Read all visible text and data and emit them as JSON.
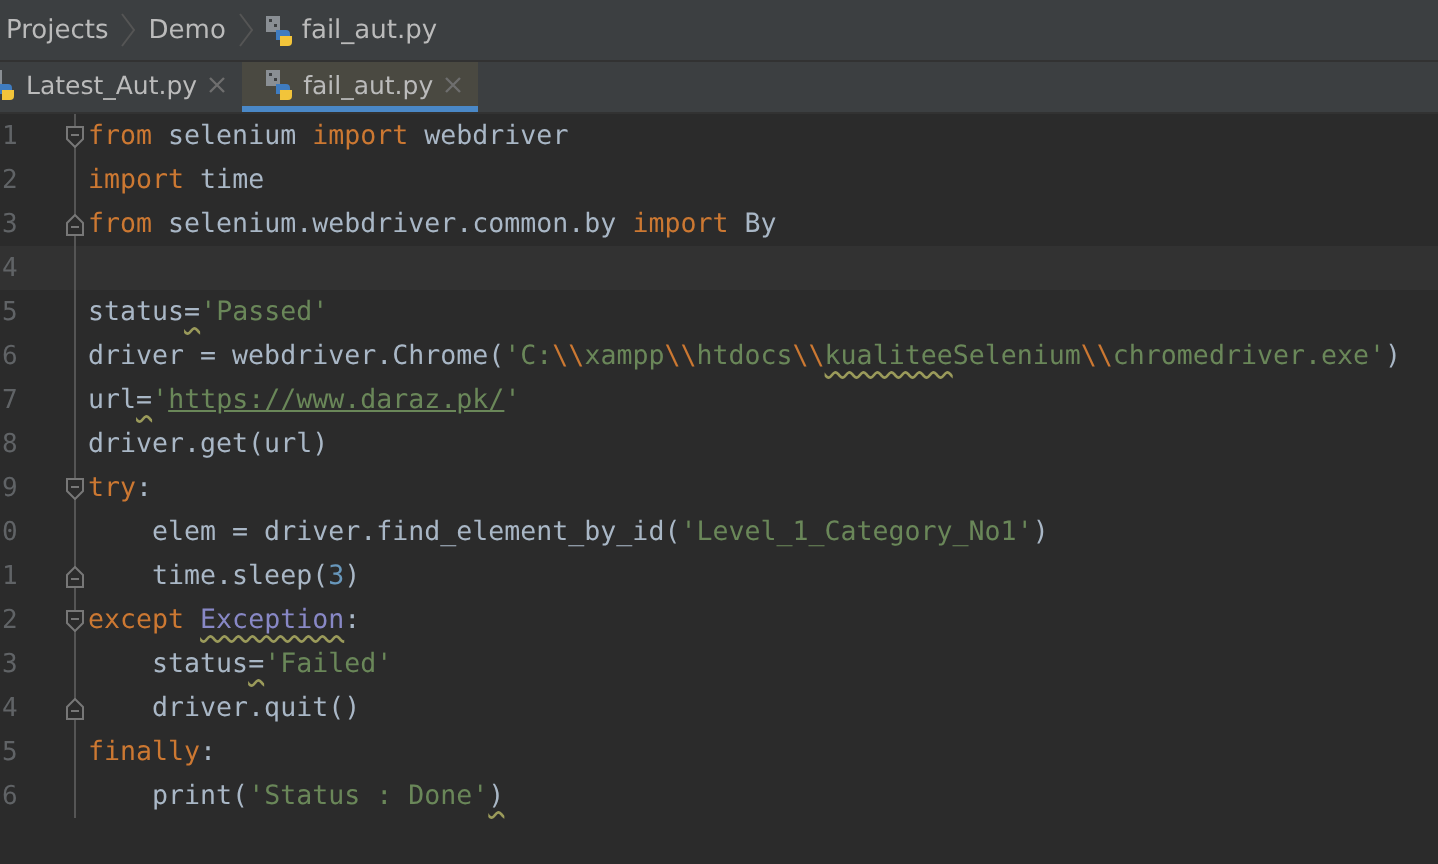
{
  "breadcrumbs": [
    {
      "label": "Projects",
      "kind": "folder"
    },
    {
      "label": "Demo",
      "kind": "folder"
    },
    {
      "label": "fail_aut.py",
      "kind": "file"
    }
  ],
  "tabs": [
    {
      "label": "Latest_Aut.py",
      "selected": false
    },
    {
      "label": "fail_aut.py",
      "selected": true
    }
  ],
  "editor": {
    "lines": [
      {
        "number": "1",
        "fold_open": true,
        "fold_close": false,
        "current": false,
        "tokens": [
          {
            "text": "from",
            "kind": "keyword",
            "warning": false
          },
          {
            "text": " selenium ",
            "kind": "plain",
            "warning": false
          },
          {
            "text": "import",
            "kind": "keyword",
            "warning": false
          },
          {
            "text": " webdriver",
            "kind": "plain",
            "warning": false
          }
        ]
      },
      {
        "number": "2",
        "fold_open": false,
        "fold_close": false,
        "current": false,
        "tokens": [
          {
            "text": "import",
            "kind": "keyword",
            "warning": false
          },
          {
            "text": " time",
            "kind": "plain",
            "warning": false
          }
        ]
      },
      {
        "number": "3",
        "fold_open": false,
        "fold_close": true,
        "current": false,
        "tokens": [
          {
            "text": "from",
            "kind": "keyword",
            "warning": false
          },
          {
            "text": " selenium.webdriver.common.by ",
            "kind": "plain",
            "warning": false
          },
          {
            "text": "import",
            "kind": "keyword",
            "warning": false
          },
          {
            "text": " By",
            "kind": "plain",
            "warning": false
          }
        ]
      },
      {
        "number": "4",
        "fold_open": false,
        "fold_close": false,
        "current": true
      },
      {
        "number": "5",
        "fold_open": false,
        "fold_close": false,
        "current": false,
        "tokens": [
          {
            "text": "status",
            "kind": "plain",
            "warning": false
          },
          {
            "text": "=",
            "kind": "plain",
            "warning": true
          },
          {
            "text": "'Passed'",
            "kind": "string",
            "warning": false
          }
        ]
      },
      {
        "number": "6",
        "fold_open": false,
        "fold_close": false,
        "current": false,
        "tokens": [
          {
            "text": "driver = webdriver.Chrome(",
            "kind": "plain",
            "warning": false
          },
          {
            "text": "'C:",
            "kind": "string",
            "warning": false
          },
          {
            "text": "\\\\",
            "kind": "escape",
            "warning": false
          },
          {
            "text": "xampp",
            "kind": "string",
            "warning": false
          },
          {
            "text": "\\\\",
            "kind": "escape",
            "warning": false
          },
          {
            "text": "htdocs",
            "kind": "string",
            "warning": false
          },
          {
            "text": "\\\\",
            "kind": "escape",
            "warning": false
          },
          {
            "text": "kualitee",
            "kind": "string",
            "warning": true
          },
          {
            "text": "Selenium",
            "kind": "string",
            "warning": false
          },
          {
            "text": "\\\\",
            "kind": "escape",
            "warning": false
          },
          {
            "text": "chromedriver.exe'",
            "kind": "string",
            "warning": false
          },
          {
            "text": ")",
            "kind": "plain",
            "warning": false
          }
        ]
      },
      {
        "number": "7",
        "fold_open": false,
        "fold_close": false,
        "current": false,
        "tokens": [
          {
            "text": "url",
            "kind": "plain",
            "warning": false
          },
          {
            "text": "=",
            "kind": "plain",
            "warning": true
          },
          {
            "text": "'",
            "kind": "string",
            "warning": false
          },
          {
            "text": "https://www.daraz.pk/",
            "kind": "link",
            "warning": false
          },
          {
            "text": "'",
            "kind": "string",
            "warning": false
          }
        ]
      },
      {
        "number": "8",
        "fold_open": false,
        "fold_close": false,
        "current": false,
        "tokens": [
          {
            "text": "driver.get(url)",
            "kind": "plain",
            "warning": false
          }
        ]
      },
      {
        "number": "9",
        "fold_open": true,
        "fold_close": false,
        "current": false,
        "tokens": [
          {
            "text": "try",
            "kind": "keyword",
            "warning": false
          },
          {
            "text": ":",
            "kind": "plain",
            "warning": false
          }
        ]
      },
      {
        "number": "0",
        "fold_open": false,
        "fold_close": false,
        "current": false,
        "tokens": [
          {
            "text": "    elem = driver.find_element_by_id(",
            "kind": "plain",
            "warning": false
          },
          {
            "text": "'Level_1_Category_No1'",
            "kind": "string",
            "warning": false
          },
          {
            "text": ")",
            "kind": "plain",
            "warning": false
          }
        ]
      },
      {
        "number": "1",
        "fold_open": false,
        "fold_close": true,
        "current": false,
        "tokens": [
          {
            "text": "    time.sleep(",
            "kind": "plain",
            "warning": false
          },
          {
            "text": "3",
            "kind": "number",
            "warning": false
          },
          {
            "text": ")",
            "kind": "plain",
            "warning": false
          }
        ]
      },
      {
        "number": "2",
        "fold_open": true,
        "fold_close": false,
        "current": false,
        "tokens": [
          {
            "text": "except ",
            "kind": "keyword",
            "warning": false
          },
          {
            "text": "Exception",
            "kind": "builtin",
            "warning": true
          },
          {
            "text": ":",
            "kind": "plain",
            "warning": false
          }
        ]
      },
      {
        "number": "3",
        "fold_open": false,
        "fold_close": false,
        "current": false,
        "tokens": [
          {
            "text": "    status",
            "kind": "plain",
            "warning": false
          },
          {
            "text": "=",
            "kind": "plain",
            "warning": true
          },
          {
            "text": "'Failed'",
            "kind": "string",
            "warning": false
          }
        ]
      },
      {
        "number": "4",
        "fold_open": false,
        "fold_close": true,
        "current": false,
        "tokens": [
          {
            "text": "    driver.quit()",
            "kind": "plain",
            "warning": false
          }
        ]
      },
      {
        "number": "5",
        "fold_open": false,
        "fold_close": false,
        "current": false,
        "tokens": [
          {
            "text": "finally",
            "kind": "keyword",
            "warning": false
          },
          {
            "text": ":",
            "kind": "plain",
            "warning": false
          }
        ]
      },
      {
        "number": "6",
        "fold_open": false,
        "fold_close": false,
        "current": false,
        "tokens": [
          {
            "text": "    print(",
            "kind": "plain",
            "warning": false
          },
          {
            "text": "'Status : Done'",
            "kind": "string",
            "warning": false
          },
          {
            "text": ")",
            "kind": "plain",
            "warning": true
          }
        ]
      }
    ]
  }
}
